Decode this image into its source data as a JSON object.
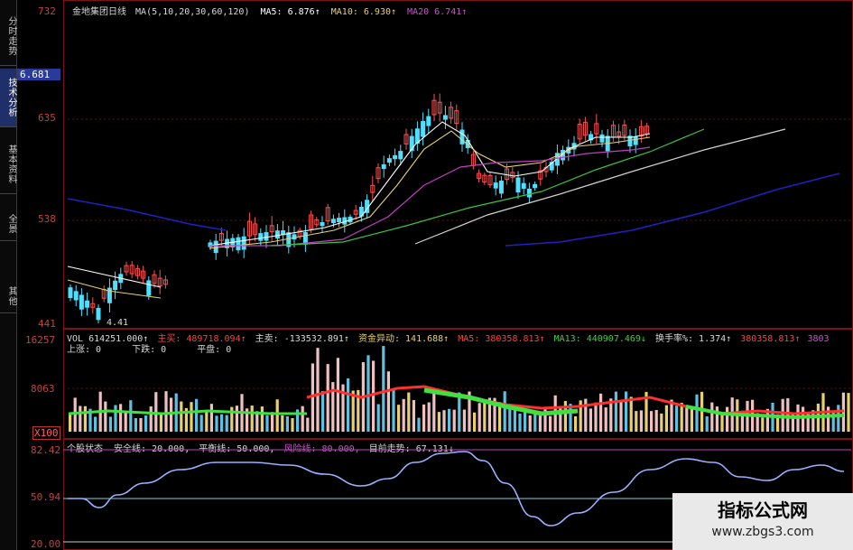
{
  "side_tabs": [
    "分时走势",
    "技术分析",
    "基本资料",
    "全景",
    "其他"
  ],
  "active_tab": 1,
  "price_axis": {
    "top": "732",
    "current": "6.681",
    "mid1": "635",
    "mid2": "538",
    "bottom": "441"
  },
  "volume_axis": {
    "top": "16257",
    "mid": "8063",
    "bottom": "X100"
  },
  "osc_axis": {
    "top": "82.42",
    "mid": "50.94",
    "bottom": "20.00"
  },
  "price_header": {
    "name": "金地集团日线",
    "ma_params": "MA(5,10,20,30,60,120)",
    "ma5": "MA5: 6.876↑",
    "ma10": "MA10: 6.930↑",
    "ma20": "MA20  6.741↑"
  },
  "low_label": "4.41",
  "volume_header": {
    "vol": "VOL 614251.000↑",
    "v2": "主买: 489718.094↑",
    "v3": "主卖: -133532.891↑",
    "v4": "资金异动: 141.688↑",
    "v5": "MA5: 380358.813↑",
    "v6": "MA13: 440907.469↓",
    "v7": "换手率%: 1.374↑",
    "v8": "380358.813↑",
    "v9": "3803"
  },
  "volume_sub": {
    "up": "上涨: 0",
    "down": "下跌: 0",
    "flat": "平盘: 0"
  },
  "osc_header": {
    "name": "个股状态",
    "safe": "安全线: 20.000,",
    "balance": "平衡线: 50.000,",
    "risk": "风险线: 80.000,",
    "trend": "目前走势: 67.131↓"
  },
  "watermark": {
    "title": "指标公式网",
    "url": "www.zbgs3.com"
  },
  "colors": {
    "up": "#ff5050",
    "down": "#50e0ff",
    "axis": "#c84040",
    "ma5": "#ffffff",
    "ma10": "#e8d070",
    "ma20": "#c040c0",
    "ma60": "#40c040",
    "ma120": "#2020c0",
    "osc": "#9ab0ff"
  }
}
